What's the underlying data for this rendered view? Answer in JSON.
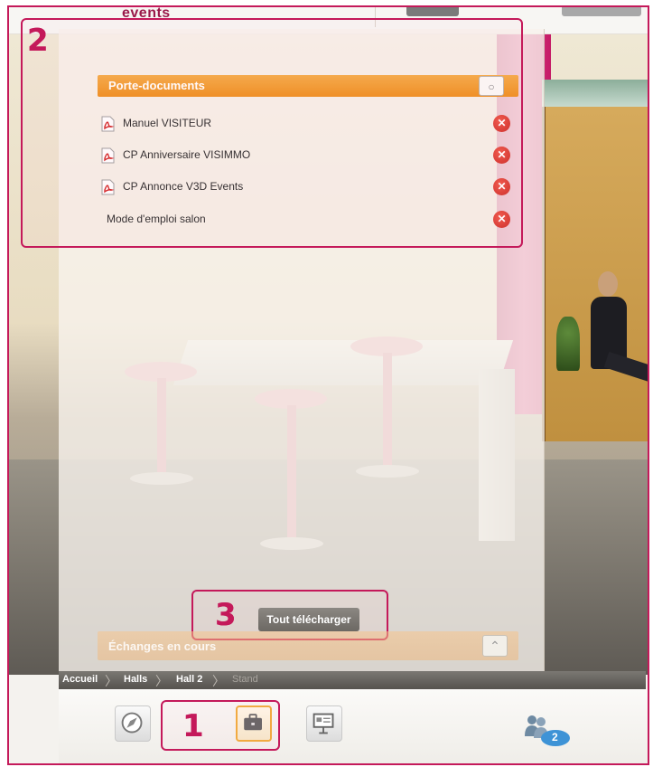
{
  "header": {
    "logo_text": "events"
  },
  "porte_documents": {
    "title": "Porte-documents",
    "collapse_symbol": "○",
    "documents": [
      {
        "name": "Manuel  VISITEUR",
        "has_pdf_icon": true
      },
      {
        "name": "CP Anniversaire VISIMMO",
        "has_pdf_icon": true
      },
      {
        "name": "CP Annonce V3D Events",
        "has_pdf_icon": true
      },
      {
        "name": "Mode d'emploi salon",
        "has_pdf_icon": false
      }
    ],
    "delete_symbol": "✕"
  },
  "download_all": {
    "label": "Tout télécharger"
  },
  "echanges": {
    "title": "Échanges en cours",
    "toggle_symbol": "⌃"
  },
  "breadcrumb": {
    "items": [
      {
        "label": "Accueil",
        "current": false
      },
      {
        "label": "Halls",
        "current": false
      },
      {
        "label": "Hall 2",
        "current": false
      },
      {
        "label": "Stand",
        "current": true
      }
    ],
    "separator": "〉"
  },
  "toolbar": {
    "buttons": [
      {
        "name": "compass-icon",
        "active": false
      },
      {
        "name": "briefcase-icon",
        "active": true
      },
      {
        "name": "presentation-icon",
        "active": false
      }
    ],
    "users_count": "2"
  },
  "annotations": [
    {
      "number": "2"
    },
    {
      "number": "3"
    },
    {
      "number": "1"
    }
  ],
  "colors": {
    "accent": "#c4195a",
    "orange": "#ee8a14",
    "delete_red": "#d22a20"
  }
}
